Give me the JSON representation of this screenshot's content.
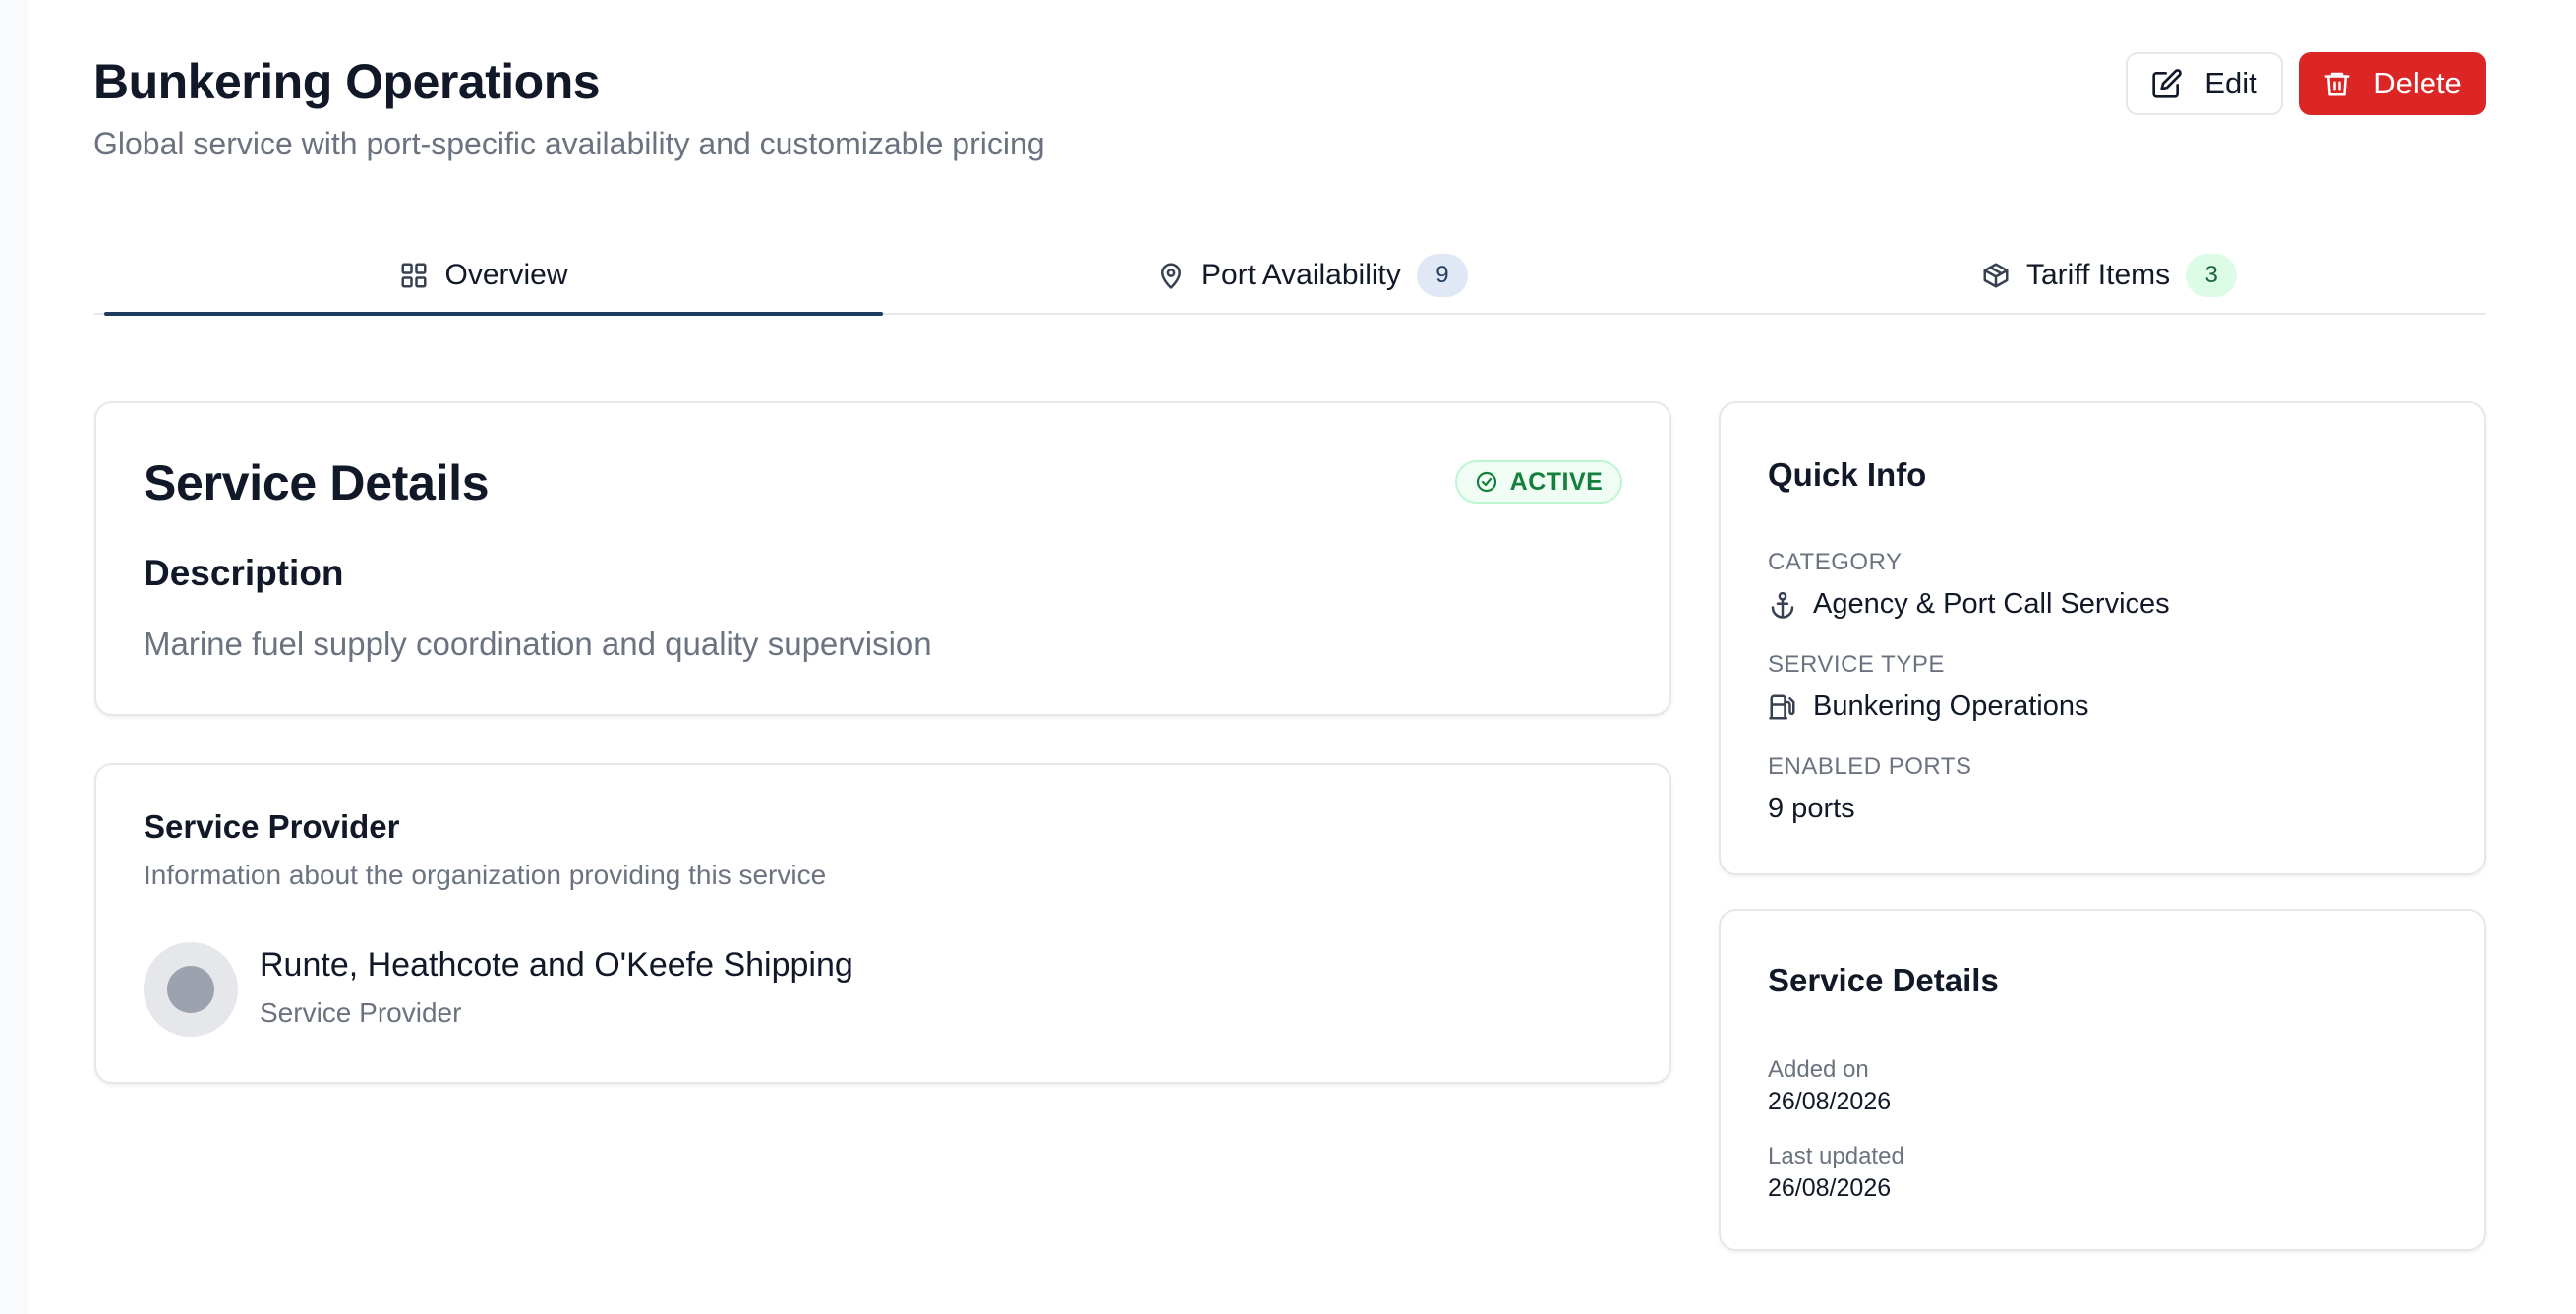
{
  "header": {
    "title": "Bunkering Operations",
    "subtitle": "Global service with port-specific availability and customizable pricing",
    "edit_label": "Edit",
    "delete_label": "Delete"
  },
  "tabs": [
    {
      "label": "Overview",
      "icon": "grid-icon",
      "active": true
    },
    {
      "label": "Port Availability",
      "icon": "map-pin-icon",
      "count": "9"
    },
    {
      "label": "Tariff Items",
      "icon": "package-icon",
      "count": "3"
    }
  ],
  "service_details": {
    "title": "Service Details",
    "status": "ACTIVE",
    "description_heading": "Description",
    "description": "Marine fuel supply coordination and quality supervision"
  },
  "provider": {
    "title": "Service Provider",
    "description": "Information about the organization providing this service",
    "name": "Runte, Heathcote and O'Keefe Shipping",
    "role": "Service Provider"
  },
  "quick_info": {
    "title": "Quick Info",
    "category_label": "CATEGORY",
    "category_value": "Agency & Port Call Services",
    "service_type_label": "SERVICE TYPE",
    "service_type_value": "Bunkering Operations",
    "enabled_ports_label": "ENABLED PORTS",
    "enabled_ports_value": "9 ports"
  },
  "meta": {
    "title": "Service Details",
    "added_label": "Added on",
    "added_value": "26/08/2026",
    "updated_label": "Last updated",
    "updated_value": "26/08/2026"
  },
  "colors": {
    "accent": "#1e3a5f",
    "danger": "#dc2626",
    "success": "#15803d"
  }
}
